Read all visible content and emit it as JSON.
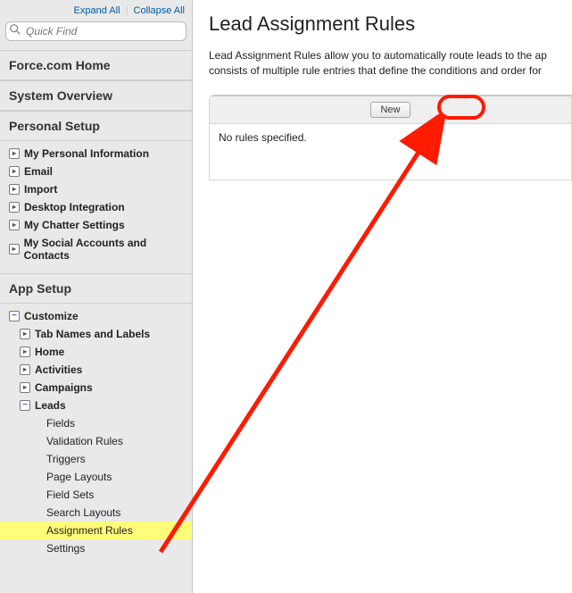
{
  "topLinks": {
    "expand": "Expand All",
    "collapse": "Collapse All"
  },
  "quickFind": {
    "placeholder": "Quick Find"
  },
  "sections": {
    "forceHome": "Force.com Home",
    "systemOverview": "System Overview",
    "personalSetup": "Personal Setup",
    "appSetup": "App Setup"
  },
  "personalItems": [
    "My Personal Information",
    "Email",
    "Import",
    "Desktop Integration",
    "My Chatter Settings",
    "My Social Accounts and Contacts"
  ],
  "appSetup": {
    "customize": "Customize",
    "customizeChildren": [
      "Tab Names and Labels",
      "Home",
      "Activities",
      "Campaigns"
    ],
    "leads": "Leads",
    "leadsChildren": [
      "Fields",
      "Validation Rules",
      "Triggers",
      "Page Layouts",
      "Field Sets",
      "Search Layouts",
      "Assignment Rules",
      "Settings"
    ]
  },
  "main": {
    "title": "Lead Assignment Rules",
    "desc1": "Lead Assignment Rules allow you to automatically route leads to the ap",
    "desc2": "consists of multiple rule entries that define the conditions and order for ",
    "newBtn": "New",
    "empty": "No rules specified."
  }
}
